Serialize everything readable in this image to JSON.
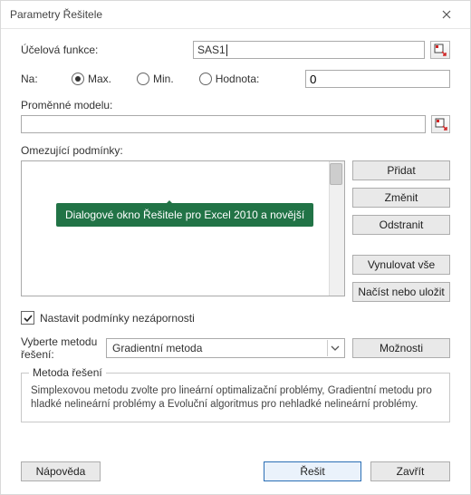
{
  "window": {
    "title": "Parametry Řešitele"
  },
  "objective": {
    "label": "Účelová funkce:",
    "value": "SAS1"
  },
  "target": {
    "label": "Na:",
    "options": {
      "max": "Max.",
      "min": "Min.",
      "value": "Hodnota:"
    },
    "value_input": "0"
  },
  "variables": {
    "label": "Proměnné modelu:",
    "value": ""
  },
  "constraints": {
    "label": "Omezující podmínky:",
    "tooltip": "Dialogové okno Řešitele pro Excel 2010 a novější",
    "buttons": {
      "add": "Přidat",
      "change": "Změnit",
      "delete": "Odstranit",
      "reset": "Vynulovat vše",
      "loadsave": "Načíst nebo uložit"
    }
  },
  "nonneg": {
    "label": "Nastavit podmínky nezápornosti"
  },
  "method": {
    "label": "Vyberte metodu řešení:",
    "selected": "Gradientní metoda",
    "options_btn": "Možnosti"
  },
  "methodbox": {
    "legend": "Metoda řešení",
    "desc": "Simplexovou metodu zvolte pro lineární optimalizační problémy, Gradientní metodu pro hladké nelineární problémy a Evoluční algoritmus pro nehladké nelineární problémy."
  },
  "footer": {
    "help": "Nápověda",
    "solve": "Řešit",
    "close": "Zavřít"
  }
}
